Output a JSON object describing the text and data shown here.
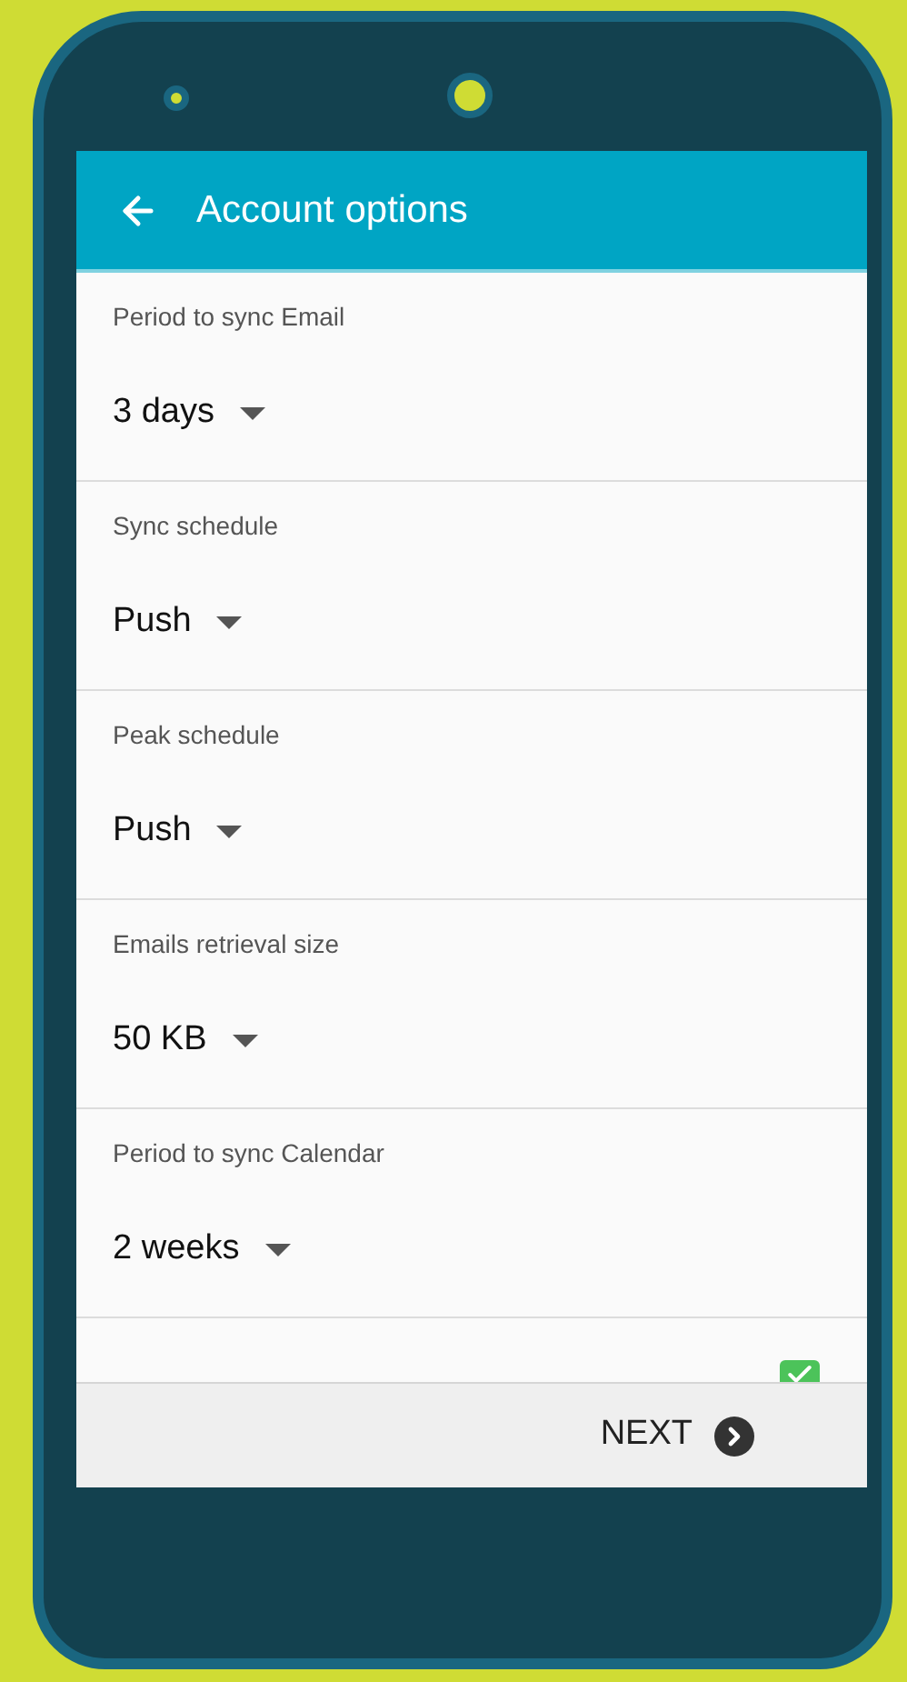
{
  "header": {
    "title": "Account options"
  },
  "settings": [
    {
      "label": "Period to sync Email",
      "value": "3 days"
    },
    {
      "label": "Sync schedule",
      "value": "Push"
    },
    {
      "label": "Peak schedule",
      "value": "Push"
    },
    {
      "label": "Emails retrieval size",
      "value": "50 KB"
    },
    {
      "label": "Period to sync Calendar",
      "value": "2 weeks"
    }
  ],
  "partial_row": {
    "checked": true
  },
  "footer": {
    "next_label": "NEXT"
  }
}
